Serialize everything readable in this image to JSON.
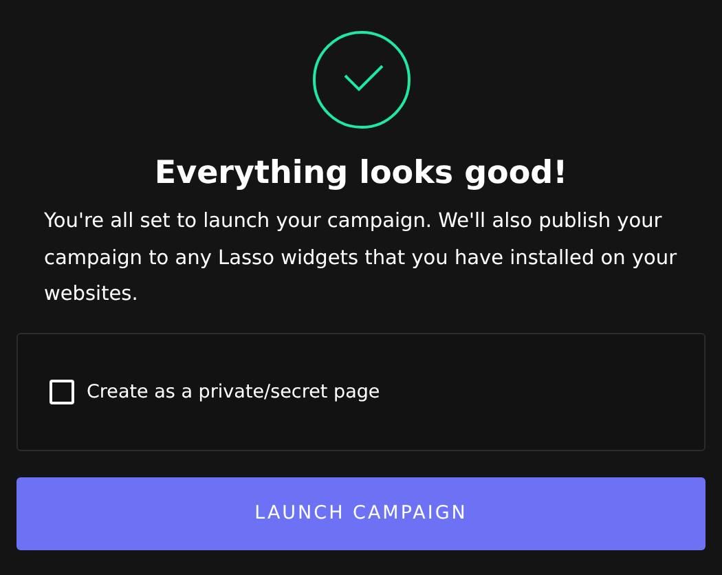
{
  "title": "Everything looks good!",
  "message": "You're all set to launch your campaign. We'll also publish your campaign to any Lasso widgets that you have installed on your websites.",
  "private_option": {
    "label": "Create as a private/secret page",
    "checked": false
  },
  "launch_button": {
    "label": "LAUNCH CAMPAIGN"
  }
}
